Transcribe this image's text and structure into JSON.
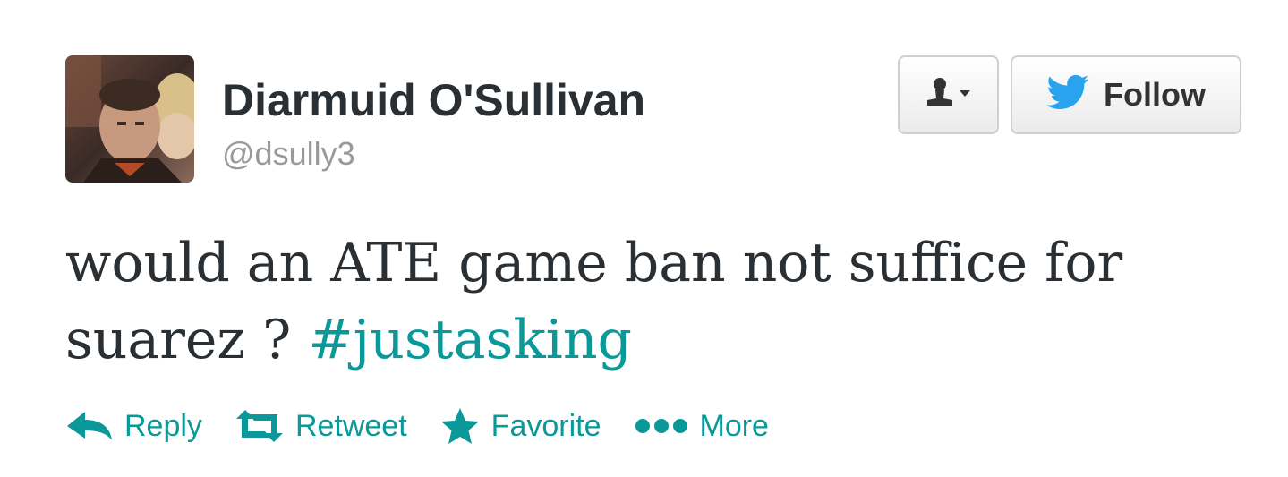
{
  "user": {
    "name": "Diarmuid O'Sullivan",
    "handle": "@dsully3"
  },
  "buttons": {
    "follow_label": "Follow",
    "user_menu_icon": "user-dropdown-icon",
    "follow_icon": "twitter-bird-icon"
  },
  "tweet": {
    "text_line1": "would an ATE game ban not suffice for",
    "text_line2": "suarez ?",
    "hashtag": "#justasking"
  },
  "actions": {
    "reply": "Reply",
    "retweet": "Retweet",
    "favorite": "Favorite",
    "more": "More"
  },
  "colors": {
    "link": "#0a9898",
    "text": "#292f33",
    "muted": "#999999",
    "twitter_blue": "#2aa3ef"
  }
}
